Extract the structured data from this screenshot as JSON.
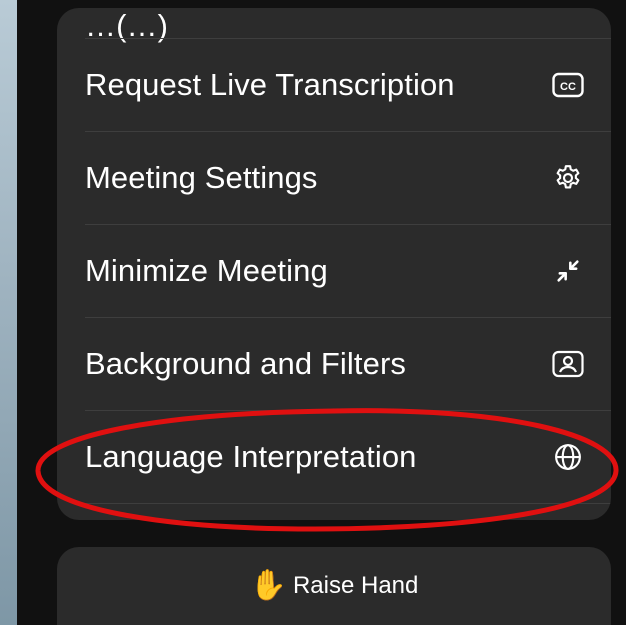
{
  "menu": {
    "partial_label": "…(…)",
    "items": [
      {
        "label": "Request Live Transcription",
        "icon": "closed-captions-icon"
      },
      {
        "label": "Meeting Settings",
        "icon": "gear-icon"
      },
      {
        "label": "Minimize Meeting",
        "icon": "minimize-arrows-icon"
      },
      {
        "label": "Background and Filters",
        "icon": "person-frame-icon"
      },
      {
        "label": "Language Interpretation",
        "icon": "globe-icon"
      }
    ],
    "cc_text": "CC"
  },
  "raise_hand": {
    "label": "Raise Hand",
    "emoji": "✋"
  },
  "colors": {
    "card_background": "#2b2b2b",
    "frame_background": "#111111",
    "text": "#ffffff",
    "annotation": "#e01010"
  }
}
